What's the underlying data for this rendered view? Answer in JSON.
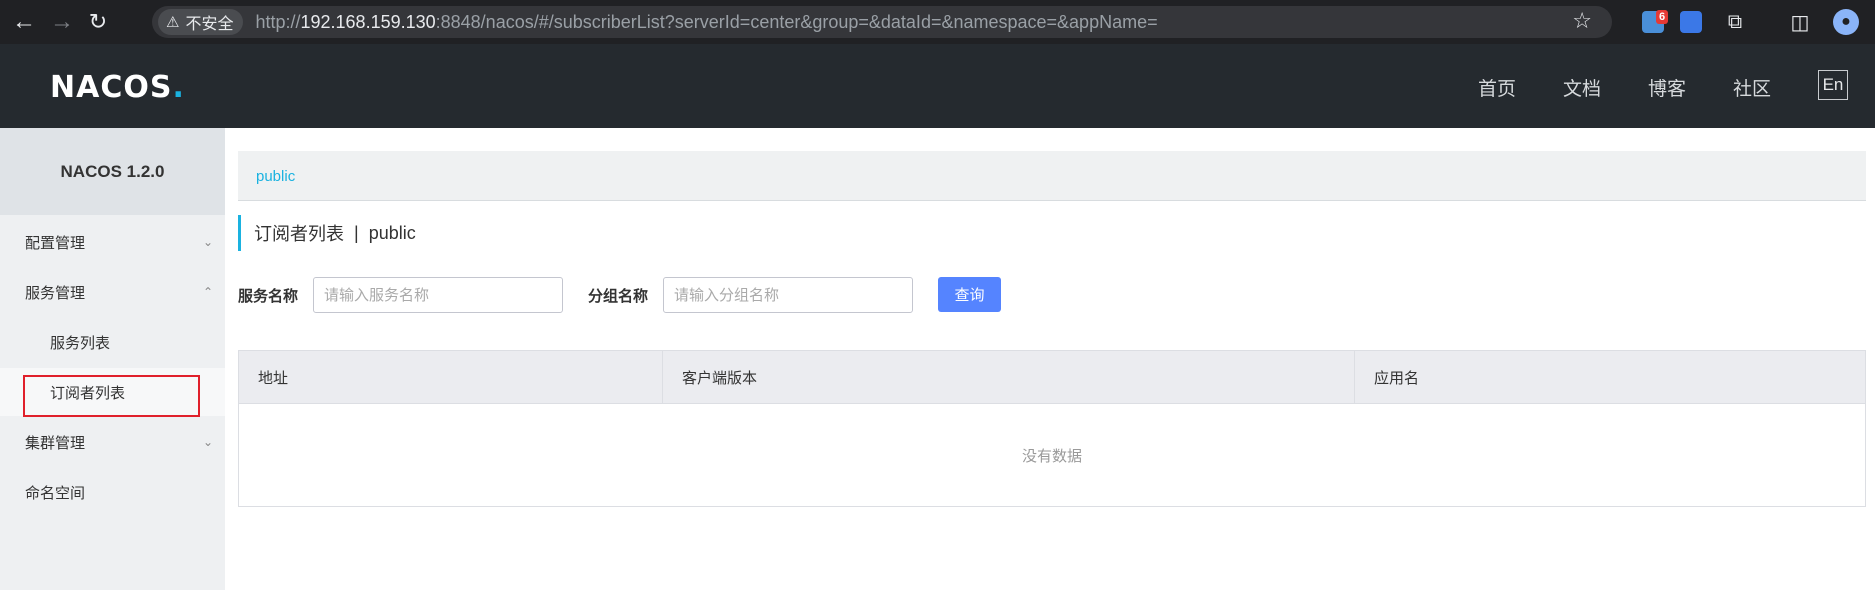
{
  "browser": {
    "security_label": "不安全",
    "url_protocol": "http://",
    "url_host": "192.168.159.130",
    "url_rest": ":8848/nacos/#/subscriberList?serverId=center&group=&dataId=&namespace=&appName=",
    "extension_badge": "6"
  },
  "header": {
    "logo_main": "NACOS",
    "logo_dot": ".",
    "nav": [
      "首页",
      "文档",
      "博客",
      "社区"
    ],
    "lang_button": "En"
  },
  "sidebar": {
    "title": "NACOS 1.2.0",
    "items": [
      {
        "label": "配置管理"
      },
      {
        "label": "服务管理"
      },
      {
        "label": "服务列表"
      },
      {
        "label": "订阅者列表"
      },
      {
        "label": "集群管理"
      },
      {
        "label": "命名空间"
      }
    ]
  },
  "main": {
    "namespace": "public",
    "page_title": "订阅者列表",
    "title_separator": "|",
    "title_namespace": "public",
    "form": {
      "service_label": "服务名称",
      "service_placeholder": "请输入服务名称",
      "group_label": "分组名称",
      "group_placeholder": "请输入分组名称",
      "query_button": "查询"
    },
    "table": {
      "columns": [
        "地址",
        "客户端版本",
        "应用名"
      ],
      "empty_text": "没有数据"
    }
  },
  "colors": {
    "accent": "#1ab2e0",
    "primary_button": "#5584ff",
    "header_bg": "#252a2f",
    "highlight": "#e0202b"
  }
}
